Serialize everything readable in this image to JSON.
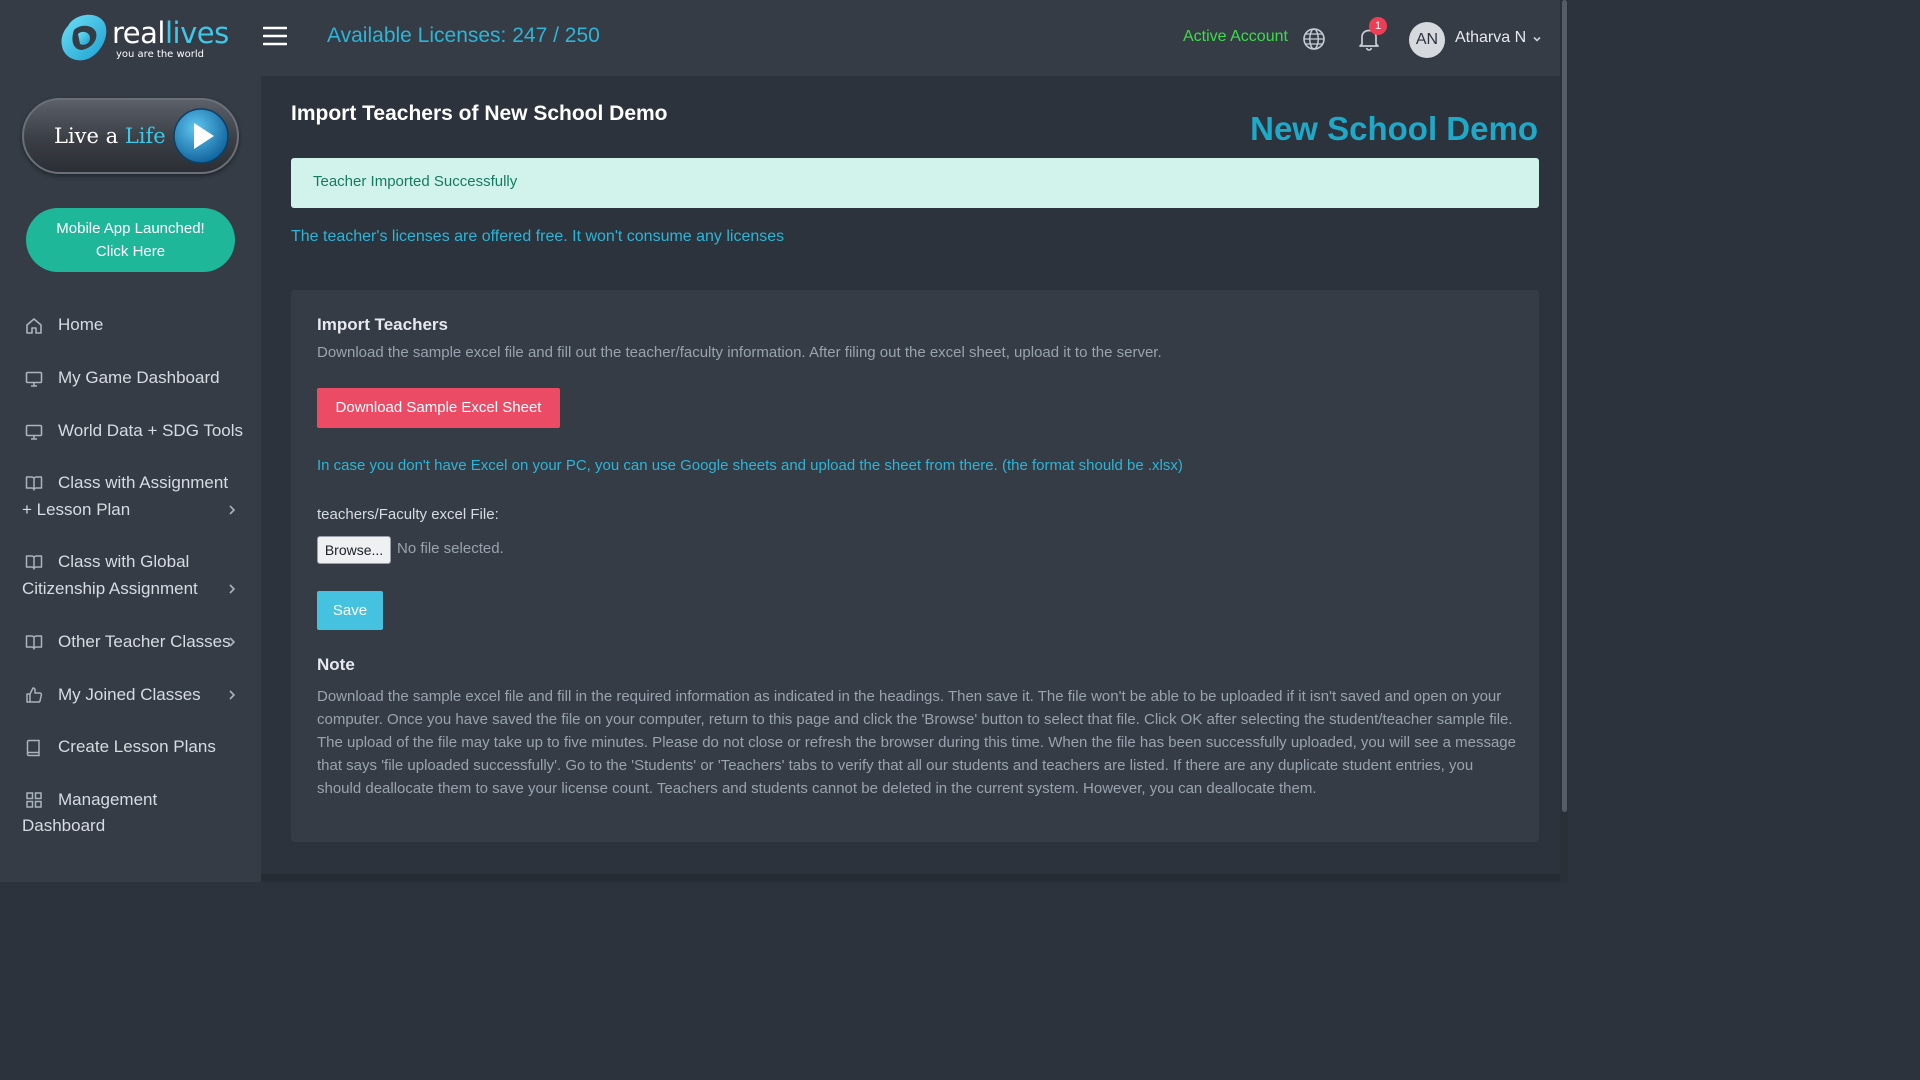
{
  "brand": {
    "logo_real": "real",
    "logo_lives": "lives",
    "tagline": "you are the world"
  },
  "promo": {
    "live_a": "Live a",
    "life": "Life",
    "mobile_app_line1": "Mobile App Launched!",
    "mobile_app_line2": "Click Here"
  },
  "sidebar": {
    "items": [
      {
        "label": "Home",
        "icon": "home-icon"
      },
      {
        "label": "My Game Dashboard",
        "icon": "monitor-icon"
      },
      {
        "label": "World Data + SDG Tools",
        "icon": "monitor-icon"
      },
      {
        "label_line1": "Class with Assignment",
        "label_line2": "+ Lesson Plan",
        "icon": "book-icon",
        "has_chevron": true
      },
      {
        "label_line1": "Class with Global",
        "label_line2": "Citizenship Assignment",
        "icon": "book-icon",
        "has_chevron": true
      },
      {
        "label": "Other Teacher Classes",
        "icon": "book-icon",
        "has_chevron": true
      },
      {
        "label": "My Joined Classes",
        "icon": "thumbs-up-icon",
        "has_chevron": true
      },
      {
        "label": "Create Lesson Plans",
        "icon": "notebook-icon"
      },
      {
        "label_line1": "Management",
        "label_line2": "Dashboard",
        "icon": "grid-icon"
      }
    ]
  },
  "header": {
    "licenses": "Available Licenses: 247 / 250",
    "account_status": "Active Account",
    "notification_count": "1",
    "avatar_initials": "AN",
    "user_name": "Atharva N"
  },
  "main": {
    "page_title": "Import Teachers of New School Demo",
    "school_name": "New School Demo",
    "alert": "Teacher Imported Successfully",
    "free_note": "The teacher's licenses are offered free. It won't consume any licenses",
    "card": {
      "title": "Import Teachers",
      "description": "Download the sample excel file and fill out the teacher/faculty information. After filing out the excel sheet, upload it to the server.",
      "download_label": "Download Sample Excel Sheet",
      "excel_hint": "In case you don't have Excel on your PC, you can use Google sheets and upload the sheet from there. (the format should be .xlsx)",
      "file_label": "teachers/Faculty excel File:",
      "browse_label": "Browse...",
      "file_status": "No file selected.",
      "save_label": "Save",
      "note_title": "Note",
      "note_body": "Download the sample excel file and fill in the required information as indicated in the headings. Then save it. The file won't be able to be uploaded if it isn't saved and open on your computer. Once you have saved the file on your computer, return to this page and click the 'Browse' button to select that file. Click OK after selecting the student/teacher sample file. The upload of the file may take up to five minutes. Please do not close or refresh the browser during this time. When the file has been successfully uploaded, you will see a message that says 'file uploaded successfully'. Go to the 'Students' or 'Teachers' tabs to verify that all our students and teachers are listed. If there are any duplicate student entries, you should deallocate them to save your license count. Teachers and students cannot be deleted in the current system. However, you can deallocate them."
    }
  },
  "colors": {
    "accent": "#2cb5d6",
    "success_bg": "#d2f3ec",
    "danger": "#ec4b66",
    "active_green": "#3ddc4a",
    "app_button": "#1fb79a"
  }
}
